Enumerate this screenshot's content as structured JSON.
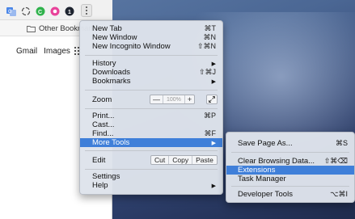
{
  "bookmarks_bar": {
    "folder_label": "Other Bookmarks"
  },
  "google_page": {
    "links": [
      "Gmail",
      "Images"
    ]
  },
  "main_menu": {
    "new_tab": {
      "label": "New Tab",
      "shortcut": "⌘T"
    },
    "new_window": {
      "label": "New Window",
      "shortcut": "⌘N"
    },
    "new_incognito": {
      "label": "New Incognito Window",
      "shortcut": "⇧⌘N"
    },
    "history": {
      "label": "History"
    },
    "downloads": {
      "label": "Downloads",
      "shortcut": "⇧⌘J"
    },
    "bookmarks": {
      "label": "Bookmarks"
    },
    "zoom": {
      "label": "Zoom",
      "minus": "—",
      "value": "100%",
      "plus": "+"
    },
    "print": {
      "label": "Print...",
      "shortcut": "⌘P"
    },
    "cast": {
      "label": "Cast..."
    },
    "find": {
      "label": "Find...",
      "shortcut": "⌘F"
    },
    "more_tools": {
      "label": "More Tools"
    },
    "edit": {
      "label": "Edit",
      "cut": "Cut",
      "copy": "Copy",
      "paste": "Paste"
    },
    "settings": {
      "label": "Settings"
    },
    "help": {
      "label": "Help"
    },
    "submenu_arrow": "▶"
  },
  "more_tools_menu": {
    "save_page_as": {
      "label": "Save Page As...",
      "shortcut": "⌘S"
    },
    "clear_browsing_data": {
      "label": "Clear Browsing Data...",
      "shortcut": "⇧⌘⌫"
    },
    "extensions": {
      "label": "Extensions"
    },
    "task_manager": {
      "label": "Task Manager"
    },
    "developer_tools": {
      "label": "Developer Tools",
      "shortcut": "⌥⌘I"
    }
  },
  "colors": {
    "highlight": "#3f7fd9",
    "menu_bg": "#dee3eb"
  }
}
